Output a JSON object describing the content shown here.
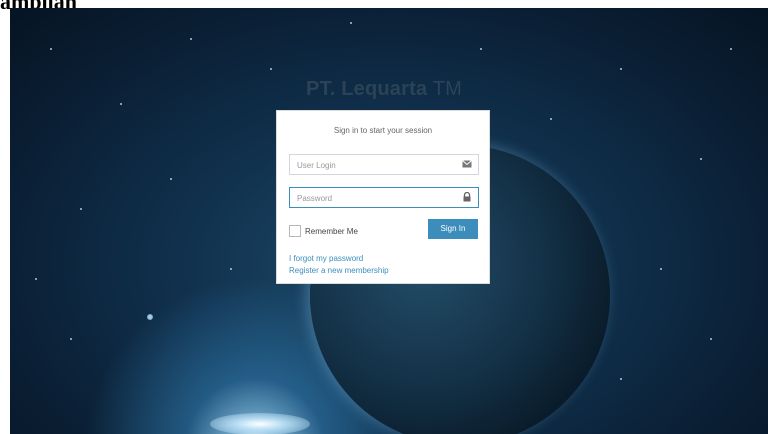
{
  "caption": {
    "text": "ampilan"
  },
  "brand": {
    "bold": "PT. Lequarta",
    "light": " TM"
  },
  "login": {
    "title": "Sign in to start your session",
    "user_placeholder": "User Login",
    "password_placeholder": "Password",
    "remember_label": "Remember Me",
    "remember_checked": false,
    "signin_label": "Sign In",
    "forgot_link": "I forgot my password",
    "register_link": "Register a new membership"
  },
  "colors": {
    "accent": "#3c8dbc",
    "brand_text": "#2c4256",
    "background_dark": "#0a1e33"
  },
  "icons": {
    "user_field": "envelope-icon",
    "password_field": "lock-icon"
  }
}
